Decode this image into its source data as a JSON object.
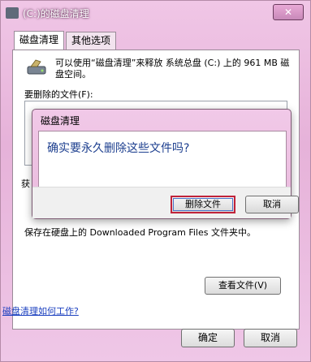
{
  "window": {
    "title": "(C:)的磁盘清理",
    "close_glyph": "✕"
  },
  "tabs": [
    {
      "label": "磁盘清理",
      "active": true
    },
    {
      "label": "其他选项",
      "active": false
    }
  ],
  "main": {
    "description": "可以使用“磁盘清理”来释放 系统总盘 (C:) 上的 961 MB 磁盘空间。",
    "files_label": "要删除的文件(F):",
    "side_fragment": "获",
    "faded_description": "保存在硬盘上的 Downloaded Program Files 文件夹中。",
    "view_files_button": "查看文件(V)",
    "help_link": "磁盘清理如何工作?"
  },
  "footer": {
    "ok_label": "确定",
    "cancel_label": "取消"
  },
  "modal": {
    "title": "磁盘清理",
    "question": "确实要永久删除这些文件吗?",
    "delete_label": "删除文件",
    "cancel_label": "取消"
  },
  "colors": {
    "accent_highlight": "#c0233a",
    "question_text": "#1d3f8f",
    "link": "#1a3fbf"
  }
}
